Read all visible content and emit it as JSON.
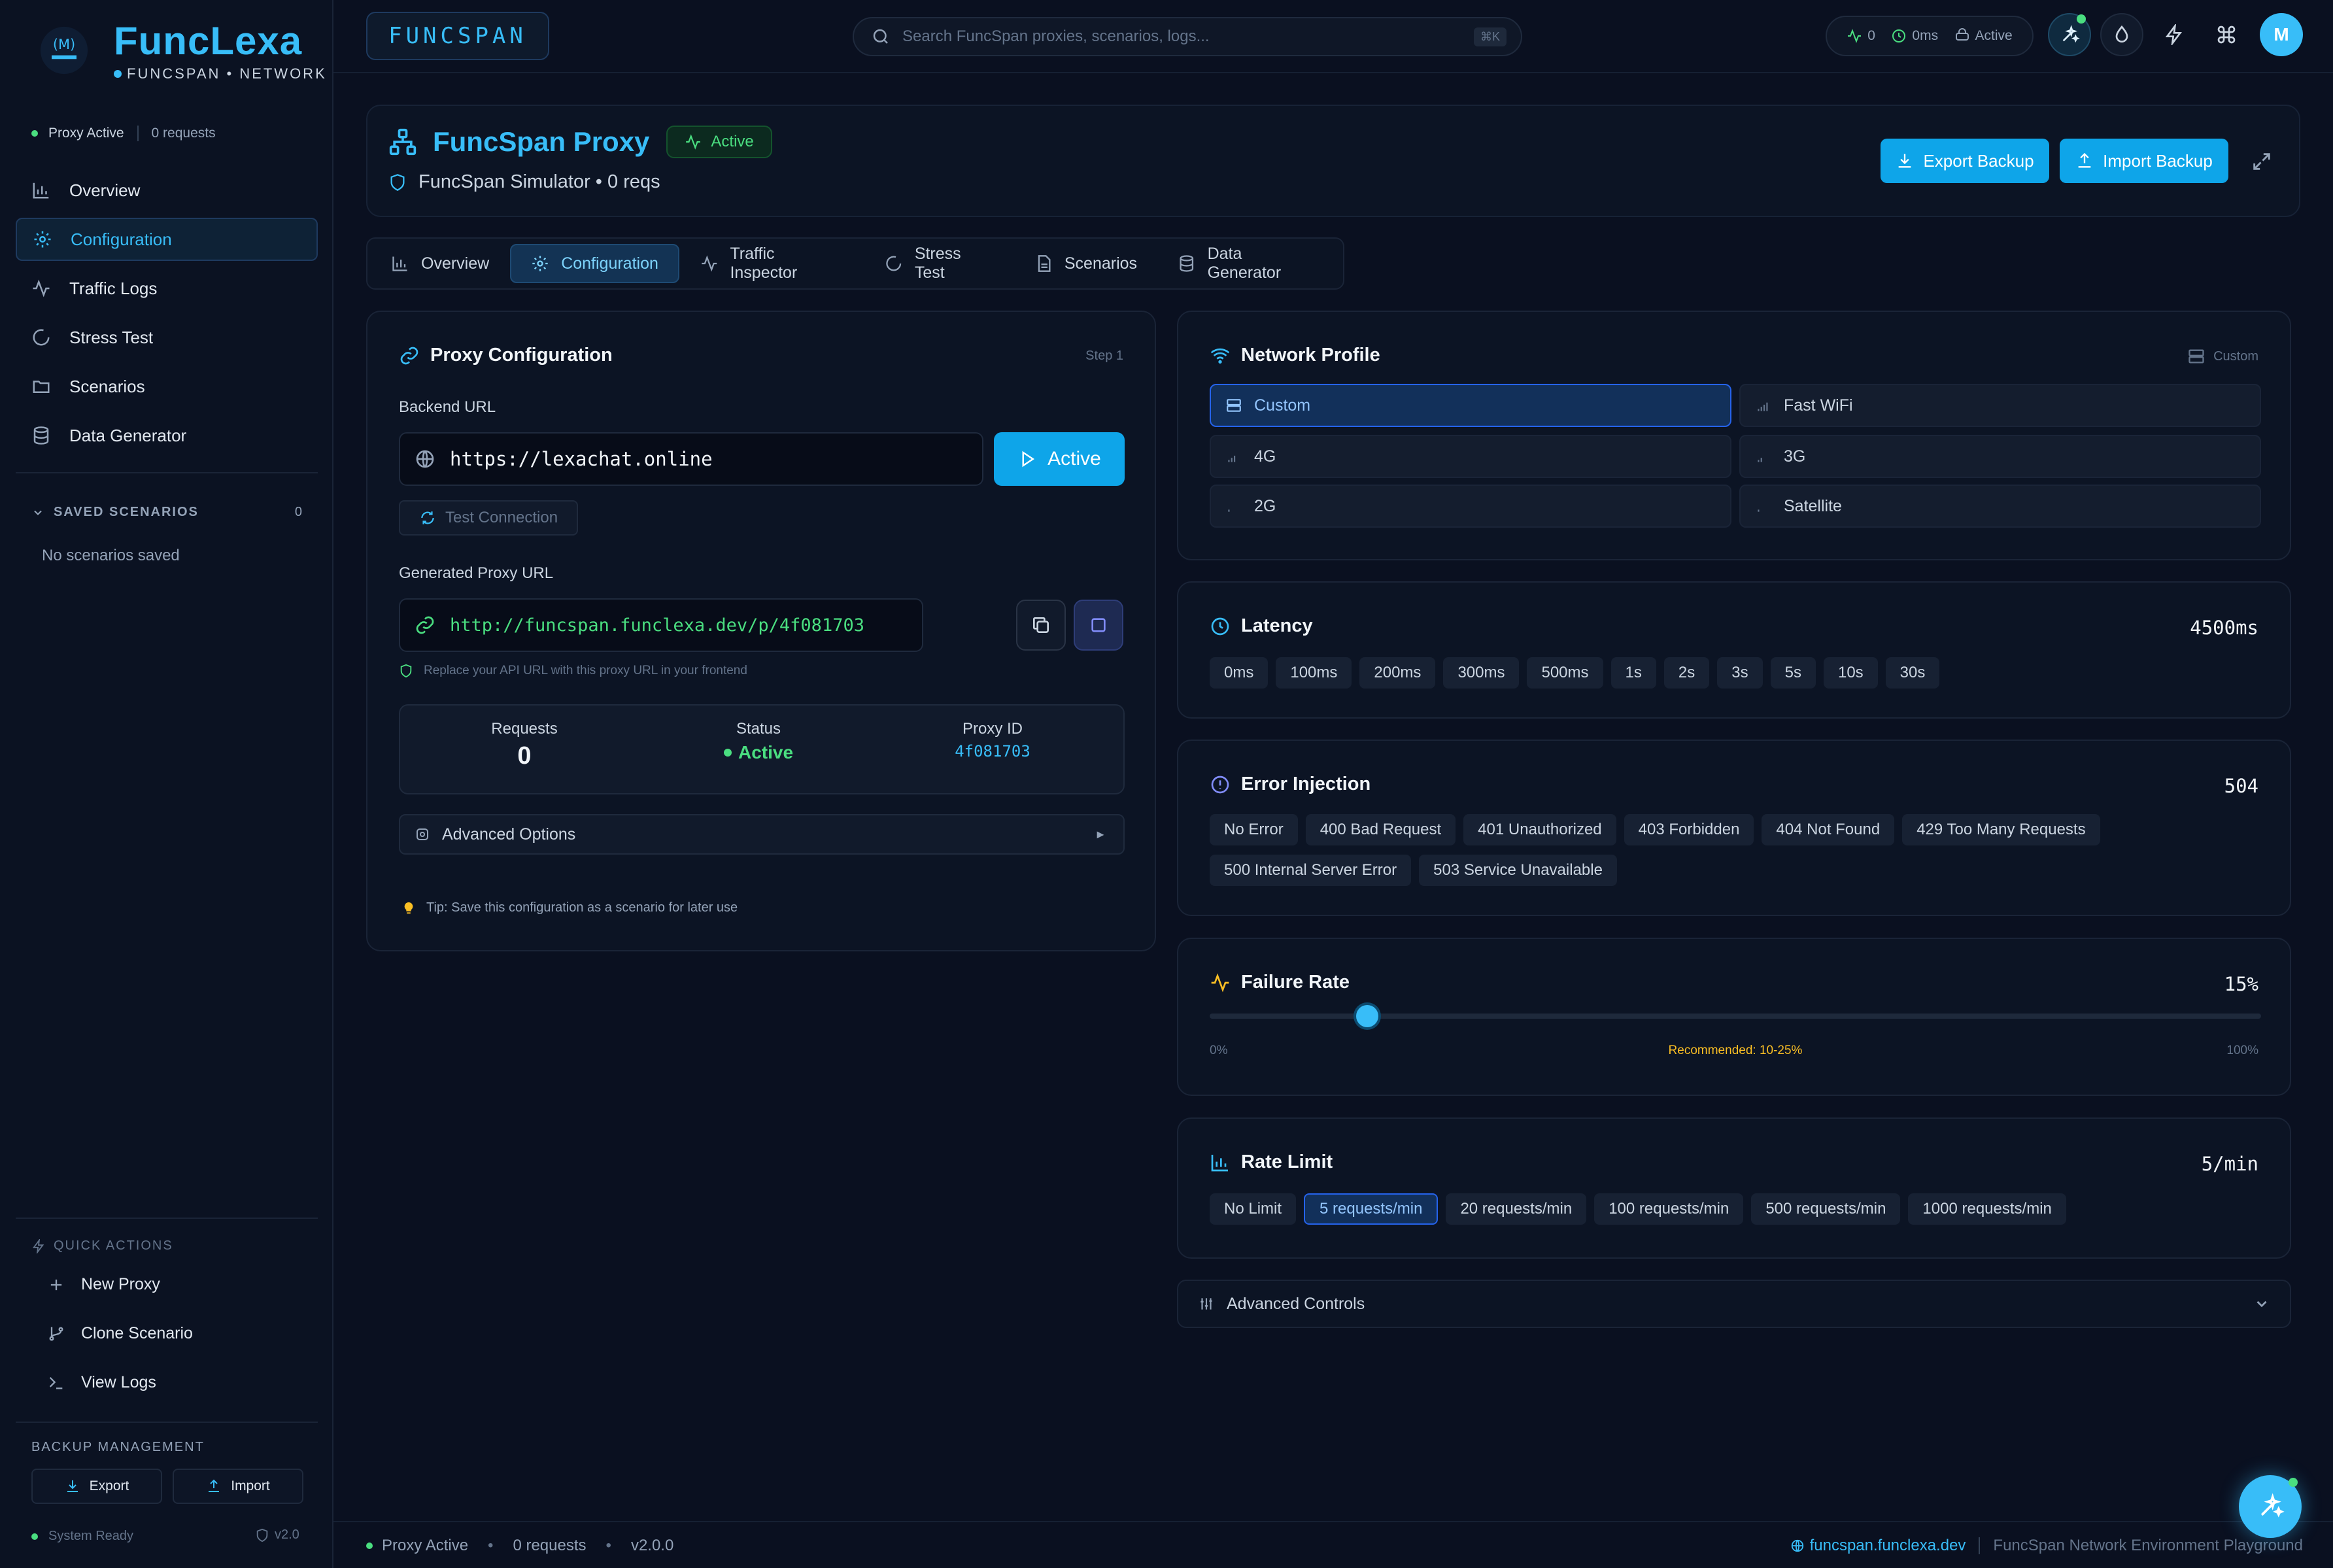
{
  "colors": {
    "accent": "#38bdf8",
    "success": "#4ade80",
    "warning": "#fbbf24",
    "background": "#0a1020"
  },
  "sidebar": {
    "logo_title": "FuncLexa",
    "logo_subtitle": "FUNCSPAN • NETWORK",
    "status": {
      "label": "Proxy Active",
      "requests": "0 requests"
    },
    "nav": [
      {
        "label": "Overview",
        "icon": "bar-chart-icon"
      },
      {
        "label": "Configuration",
        "icon": "gear-icon",
        "active": true
      },
      {
        "label": "Traffic Logs",
        "icon": "activity-icon"
      },
      {
        "label": "Stress Test",
        "icon": "loader-icon"
      },
      {
        "label": "Scenarios",
        "icon": "folder-icon"
      },
      {
        "label": "Data Generator",
        "icon": "database-icon"
      }
    ],
    "saved": {
      "title": "SAVED SCENARIOS",
      "count": "0",
      "empty": "No scenarios saved"
    },
    "quick_actions": {
      "title": "QUICK ACTIONS",
      "items": [
        {
          "label": "New Proxy",
          "icon": "plus-icon"
        },
        {
          "label": "Clone Scenario",
          "icon": "git-branch-icon"
        },
        {
          "label": "View Logs",
          "icon": "terminal-icon"
        }
      ]
    },
    "backup": {
      "title": "BACKUP MANAGEMENT",
      "export": "Export",
      "import": "Import"
    },
    "system": {
      "status": "System Ready",
      "version": "v2.0"
    }
  },
  "topbar": {
    "brand": "FUNCSPAN",
    "search_placeholder": "Search FuncSpan proxies, scenarios, logs...",
    "search_shortcut": "⌘K",
    "stats": {
      "activity": "0",
      "latency": "0ms",
      "state": "Active"
    },
    "avatar": "M"
  },
  "header": {
    "title": "FuncSpan Proxy",
    "badge": "Active",
    "subtitle": "FuncSpan Simulator • 0 reqs",
    "export_backup": "Export Backup",
    "import_backup": "Import Backup"
  },
  "tabs": [
    {
      "label": "Overview",
      "icon": "bar-chart-icon"
    },
    {
      "label": "Configuration",
      "icon": "gear-icon",
      "active": true
    },
    {
      "label": "Traffic Inspector",
      "icon": "activity-icon"
    },
    {
      "label": "Stress Test",
      "icon": "loader-icon"
    },
    {
      "label": "Scenarios",
      "icon": "file-icon"
    },
    {
      "label": "Data Generator",
      "icon": "database-icon"
    }
  ],
  "proxy_config": {
    "title": "Proxy Configuration",
    "step": "Step 1",
    "backend_label": "Backend URL",
    "backend_url": "https://lexachat.online",
    "run_button": "Active",
    "test_button": "Test Connection",
    "generated_label": "Generated Proxy URL",
    "generated_url": "http://funcspan.funclexa.dev/p/4f081703",
    "hint": "Replace your API URL with this proxy URL in your frontend",
    "stats": {
      "requests_label": "Requests",
      "requests_value": "0",
      "status_label": "Status",
      "status_value": "Active",
      "proxy_id_label": "Proxy ID",
      "proxy_id_value": "4f081703"
    },
    "advanced_options": "Advanced Options",
    "tip": "Tip: Save this configuration as a scenario for later use"
  },
  "network_profile": {
    "title": "Network Profile",
    "current": "Custom",
    "options": [
      {
        "label": "Custom",
        "selected": true
      },
      {
        "label": "Fast WiFi"
      },
      {
        "label": "4G"
      },
      {
        "label": "3G"
      },
      {
        "label": "2G"
      },
      {
        "label": "Satellite"
      }
    ]
  },
  "latency": {
    "title": "Latency",
    "value": "4500ms",
    "options": [
      "0ms",
      "100ms",
      "200ms",
      "300ms",
      "500ms",
      "1s",
      "2s",
      "3s",
      "5s",
      "10s",
      "30s"
    ]
  },
  "error_injection": {
    "title": "Error Injection",
    "value": "504",
    "options": [
      "No Error",
      "400 Bad Request",
      "401 Unauthorized",
      "403 Forbidden",
      "404 Not Found",
      "429 Too Many Requests",
      "500 Internal Server Error",
      "503 Service Unavailable"
    ]
  },
  "failure_rate": {
    "title": "Failure Rate",
    "value": "15%",
    "level": 0.15,
    "min_label": "0%",
    "max_label": "100%",
    "recommended": "Recommended: 10-25%"
  },
  "rate_limit": {
    "title": "Rate Limit",
    "value": "5/min",
    "options": [
      "No Limit",
      "5 requests/min",
      "20 requests/min",
      "100 requests/min",
      "500 requests/min",
      "1000 requests/min"
    ],
    "selected": "5 requests/min"
  },
  "advanced_controls": "Advanced Controls",
  "footer": {
    "status": "Proxy Active",
    "requests": "0 requests",
    "version": "v2.0.0",
    "host": "funcspan.funclexa.dev",
    "tagline": "FuncSpan Network Environment Playground"
  }
}
